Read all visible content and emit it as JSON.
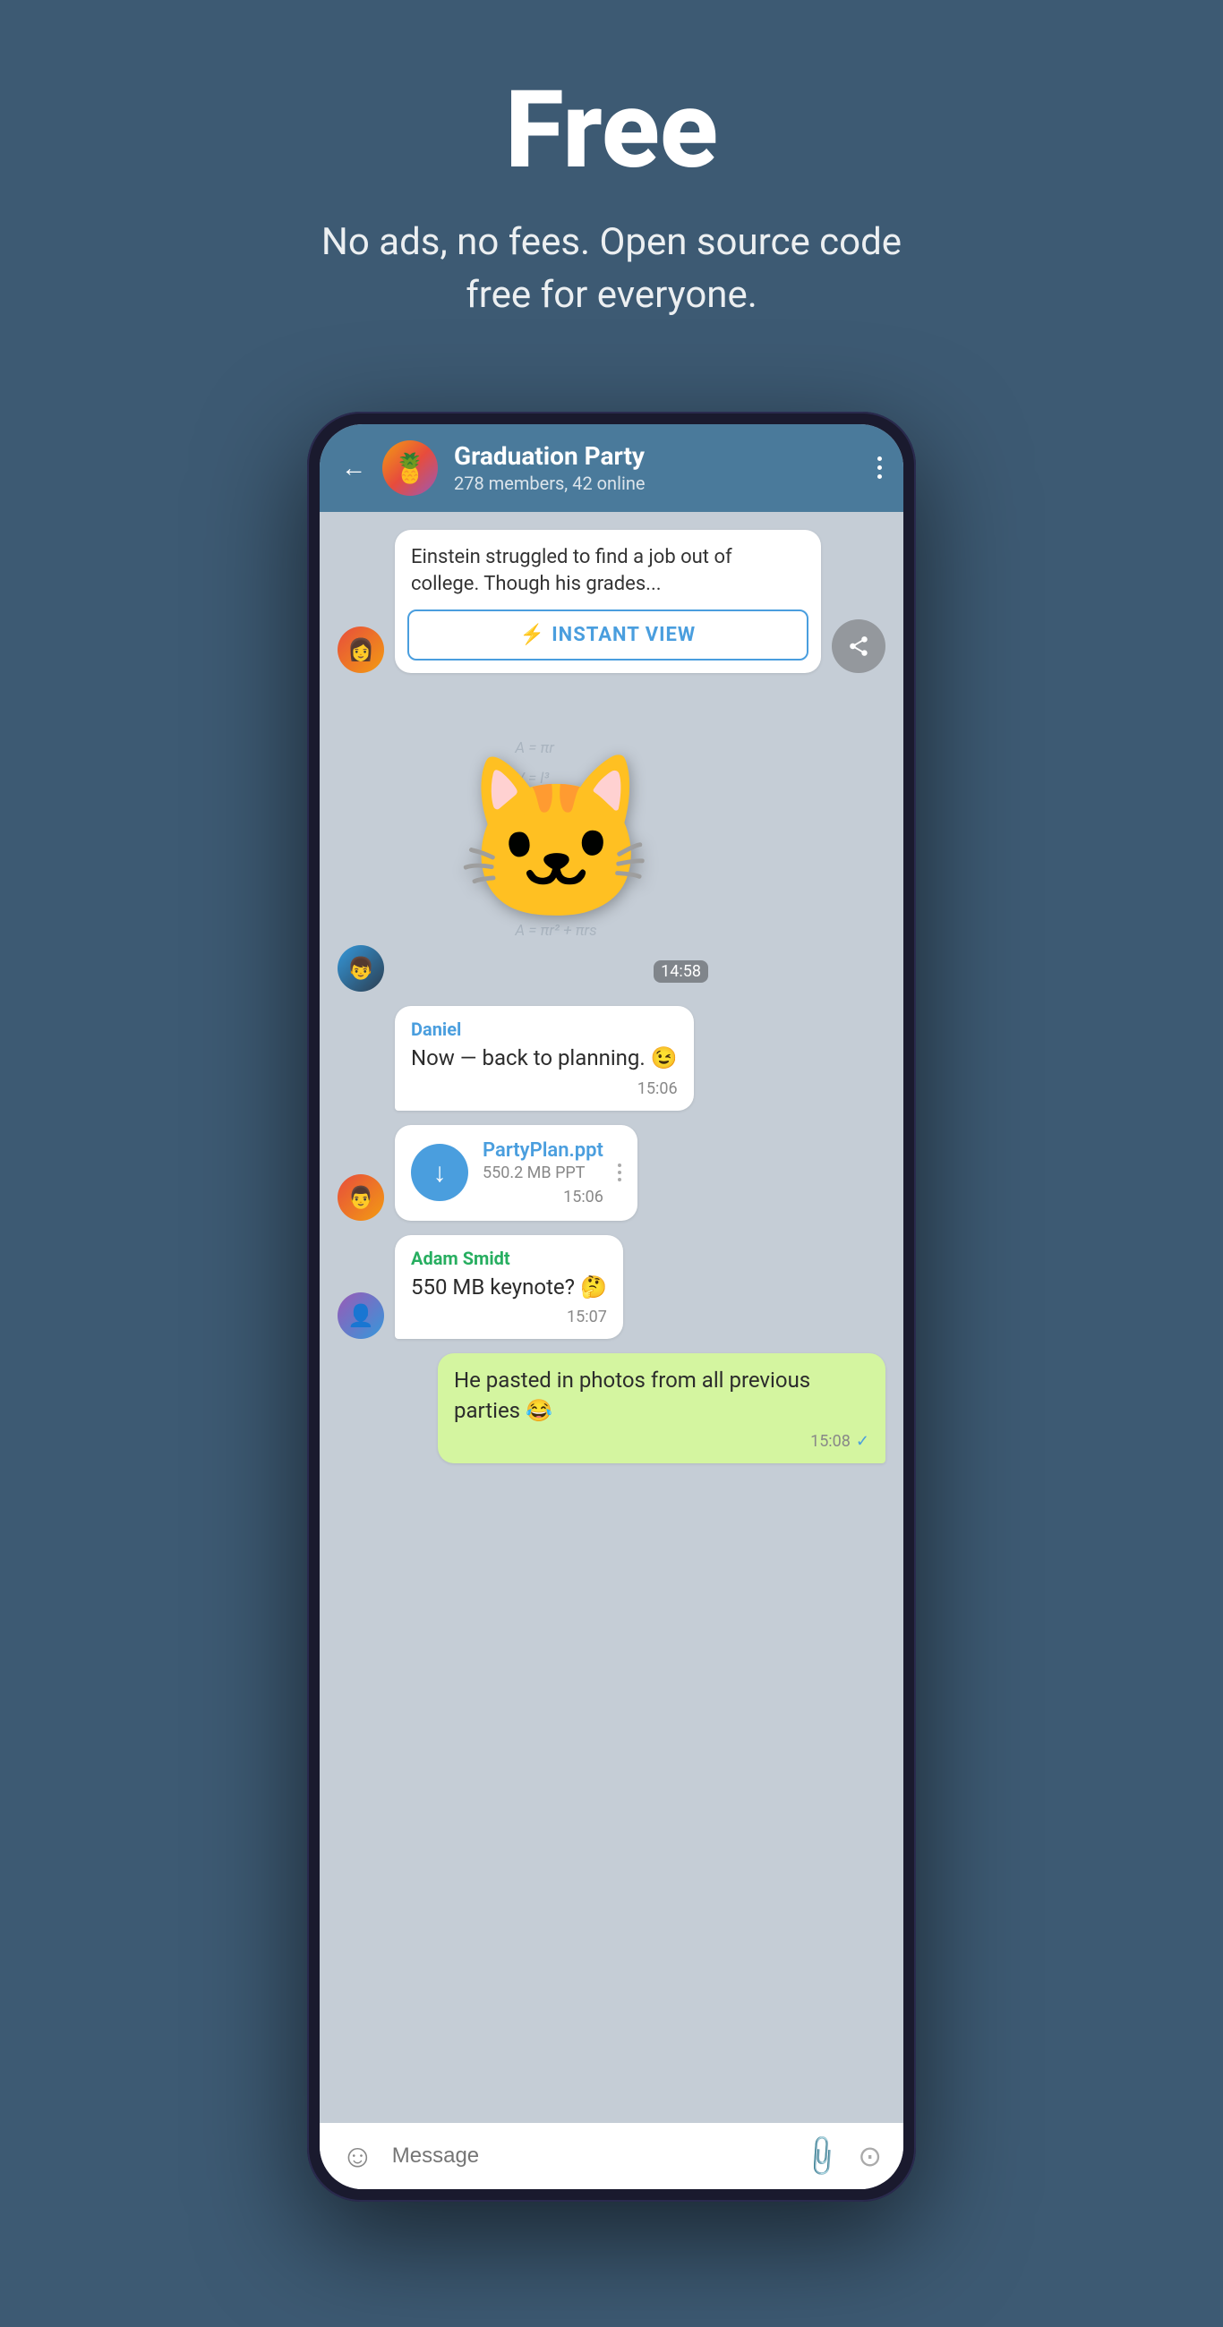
{
  "hero": {
    "title": "Free",
    "subtitle": "No ads, no fees. Open source code free for everyone."
  },
  "phone": {
    "header": {
      "back_label": "←",
      "group_name": "Graduation Party",
      "group_members": "278 members, 42 online",
      "group_emoji": "🍍"
    },
    "messages": [
      {
        "id": "article-msg",
        "type": "article",
        "text": "Einstein struggled to find a job out of college. Though his grades...",
        "instant_view_label": "INSTANT VIEW",
        "iv_icon": "⚡"
      },
      {
        "id": "sticker-msg",
        "type": "sticker",
        "time": "14:58",
        "sticker": "🐱"
      },
      {
        "id": "daniel-msg",
        "type": "text",
        "sender": "Daniel",
        "text": "Now — back to planning. 😉",
        "time": "15:06"
      },
      {
        "id": "file-msg",
        "type": "file",
        "file_name": "PartyPlan.ppt",
        "file_size": "550.2 MB PPT",
        "time": "15:06"
      },
      {
        "id": "adam-msg",
        "type": "text",
        "sender": "Adam Smidt",
        "text": "550 MB keynote? 🤔",
        "time": "15:07"
      },
      {
        "id": "self-msg",
        "type": "self",
        "text": "He pasted in photos from all previous parties 😂",
        "time": "15:08",
        "check": "✓"
      }
    ],
    "input_bar": {
      "placeholder": "Message",
      "emoji_label": "☺",
      "attach_label": "📎",
      "camera_label": "⊙"
    }
  }
}
